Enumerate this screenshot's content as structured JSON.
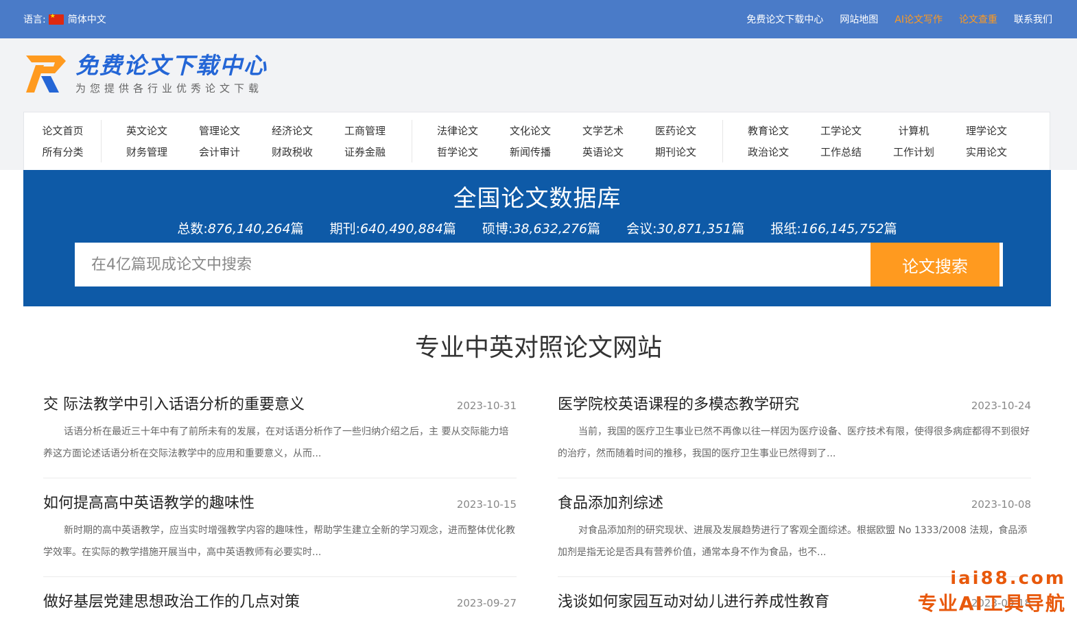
{
  "topbar": {
    "lang_label": "语言:",
    "lang_value": "简体中文",
    "links": [
      {
        "label": "免费论文下载中心",
        "highlight": false
      },
      {
        "label": "网站地图",
        "highlight": false
      },
      {
        "label": "AI论文写作",
        "highlight": true
      },
      {
        "label": "论文查重",
        "highlight": true
      },
      {
        "label": "联系我们",
        "highlight": false
      }
    ]
  },
  "logo": {
    "title": "免费论文下载中心",
    "subtitle": "为您提供各行业优秀论文下载"
  },
  "nav": {
    "groups": [
      [
        "论文首页",
        "所有分类"
      ],
      [
        "英文论文",
        "财务管理",
        "管理论文",
        "会计审计",
        "经济论文",
        "财政税收",
        "工商管理",
        "证券金融"
      ],
      [
        "法律论文",
        "哲学论文",
        "文化论文",
        "新闻传播",
        "文学艺术",
        "英语论文",
        "医药论文",
        "期刊论文"
      ],
      [
        "教育论文",
        "政治论文",
        "工学论文",
        "工作总结",
        "计算机",
        "工作计划",
        "理学论文",
        "实用论文"
      ]
    ]
  },
  "banner": {
    "title": "全国论文数据库",
    "stats": [
      {
        "label": "总数:",
        "value": "876,140,264",
        "unit": "篇"
      },
      {
        "label": "期刊:",
        "value": "640,490,884",
        "unit": "篇"
      },
      {
        "label": "硕博:",
        "value": "38,632,276",
        "unit": "篇"
      },
      {
        "label": "会议:",
        "value": "30,871,351",
        "unit": "篇"
      },
      {
        "label": "报纸:",
        "value": "166,145,752",
        "unit": "篇"
      }
    ],
    "search_placeholder": "在4亿篇现成论文中搜索",
    "search_button": "论文搜索"
  },
  "section": {
    "title": "专业中英对照论文网站"
  },
  "articles": [
    {
      "title": "交 际法教学中引入话语分析的重要意义",
      "date": "2023-10-31",
      "excerpt": "话语分析在最近三十年中有了前所未有的发展，在对话语分析作了一些归纳介绍之后，主 要从交际能力培养这方面论述话语分析在交际法教学中的应用和重要意义，从而..."
    },
    {
      "title": "医学院校英语课程的多模态教学研究",
      "date": "2023-10-24",
      "excerpt": "当前，我国的医疗卫生事业已然不再像以往一样因为医疗设备、医疗技术有限，使得很多病症都得不到很好的治疗，然而随着时间的推移，我国的医疗卫生事业已然得到了..."
    },
    {
      "title": "如何提高高中英语教学的趣味性",
      "date": "2023-10-15",
      "excerpt": "新时期的高中英语教学，应当实时增强教学内容的趣味性，帮助学生建立全新的学习观念，进而整体优化教学效率。在实际的教学措施开展当中，高中英语教师有必要实时..."
    },
    {
      "title": "食品添加剂综述",
      "date": "2023-10-08",
      "excerpt": "对食品添加剂的研究现状、进展及发展趋势进行了客观全面综述。根据欧盟 No 1333/2008 法规，食品添加剂是指无论是否具有营养价值，通常本身不作为食品，也不..."
    },
    {
      "title": "做好基层党建思想政治工作的几点对策",
      "date": "2023-09-27",
      "excerpt": ""
    },
    {
      "title": "浅谈如何家园互动对幼儿进行养成性教育",
      "date": "2023-09-18",
      "excerpt": ""
    }
  ],
  "watermark": {
    "line1": "iai88.com",
    "line2": "专业AI工具导航"
  },
  "colors": {
    "topbar": "#4a7bc8",
    "banner": "#0e5aa7",
    "accent": "#ff9a1f",
    "logo_blue": "#2466d6"
  }
}
